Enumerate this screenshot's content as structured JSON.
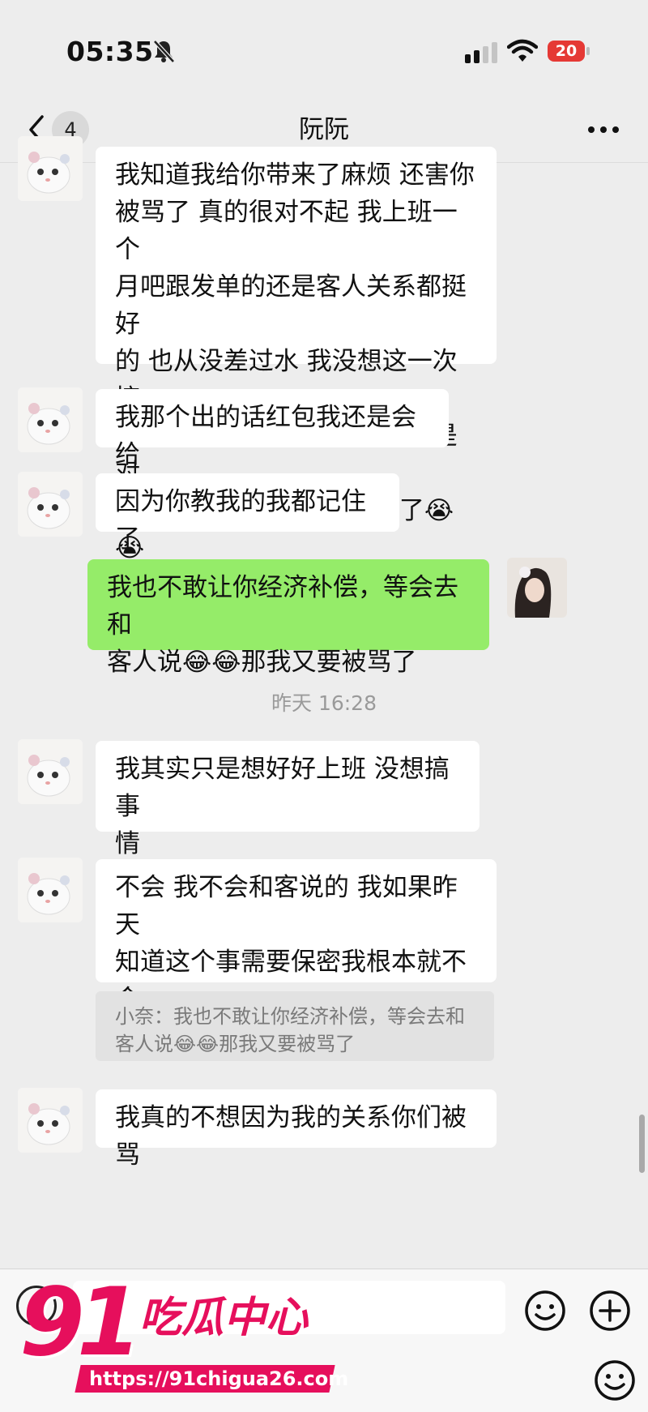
{
  "status_bar": {
    "time": "05:35",
    "battery": "20"
  },
  "nav": {
    "unread_count": "4",
    "title": "阮阮"
  },
  "messages": [
    "我知道我给你带来了麻烦 还害你\n被骂了 真的很对不起 我上班一个\n月吧跟发单的还是客人关系都挺好\n的 也从没差过水 我没想这一次搞\n成这样 真的很对不起 你骂我是对\n的 我以后肯定不会再这样了😭😭",
    "我那个出的话红包我还是会给",
    "因为你教我的我都记住了",
    "我也不敢让你经济补偿，等会去和\n客人说😂😂那我又要被骂了",
    "我其实只是想好好上班 没想搞事\n情",
    "不会 我不会和客说的 我如果昨天\n知道这个事需要保密我根本就不会\n说",
    "我真的不想因为我的关系你们被骂"
  ],
  "timestamp": "昨天 16:28",
  "quote": "小奈：我也不敢让你经济补偿，等会去和\n客人说😂😂那我又要被骂了",
  "watermark": {
    "number": "91",
    "text": "吃瓜中心",
    "url": "https://91chigua26.com"
  },
  "icons": [
    "muted-bell-icon",
    "signal-icon",
    "wifi-icon",
    "battery-icon",
    "back-chevron-icon",
    "more-dots-icon",
    "voice-icon",
    "emoji-icon",
    "plus-icon",
    "cat-avatar",
    "girl-avatar"
  ],
  "colors": {
    "background": "#ededed",
    "mine_bubble": "#95ec69",
    "theirs_bubble": "#ffffff",
    "battery": "#e53935",
    "watermark": "#e60f5c"
  }
}
